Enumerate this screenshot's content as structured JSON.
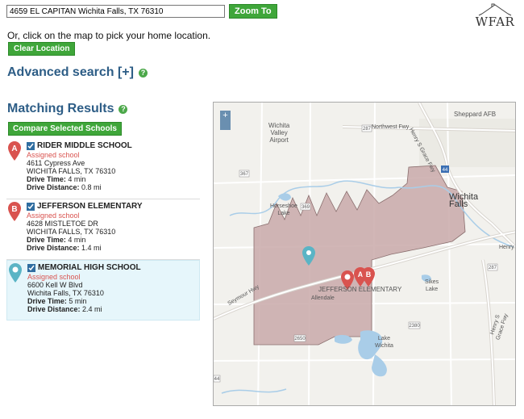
{
  "search": {
    "address_value": "4659 EL CAPITAN Wichita Falls, TX 76310",
    "zoom_label": "Zoom To"
  },
  "logo": {
    "text": "WFAR"
  },
  "pick_text": "Or, click on the map to pick your home location.",
  "clear_label": "Clear Location",
  "advanced": {
    "title": "Advanced search [+]"
  },
  "matching": {
    "title": "Matching Results",
    "compare_label": "Compare Selected Schools"
  },
  "results": [
    {
      "marker": "A",
      "name": "RIDER MIDDLE SCHOOL",
      "assigned": "Assigned school",
      "address1": "4611 Cypress Ave",
      "address2": "WICHITA FALLS, TX 76310",
      "drive_time_label": "Drive Time:",
      "drive_time": "4 min",
      "drive_distance_label": "Drive Distance:",
      "drive_distance": "0.8 mi",
      "color": "#d9534f"
    },
    {
      "marker": "B",
      "name": "JEFFERSON ELEMENTARY",
      "assigned": "Assigned school",
      "address1": "4628 MISTLETOE DR",
      "address2": "WICHITA FALLS, TX 76310",
      "drive_time_label": "Drive Time:",
      "drive_time": "4 min",
      "drive_distance_label": "Drive Distance:",
      "drive_distance": "1.4 mi",
      "color": "#d9534f"
    },
    {
      "marker": "",
      "name": "MEMORIAL HIGH SCHOOL",
      "assigned": "Assigned school",
      "address1": "6600 Kell W Blvd",
      "address2": "Wichita Falls, TX 76310",
      "drive_time_label": "Drive Time:",
      "drive_time": "5 min",
      "drive_distance_label": "Drive Distance:",
      "drive_distance": "2.4 mi",
      "color": "#5ab4c5"
    }
  ],
  "map": {
    "zoom_plus": "+",
    "labels": {
      "wichita_valley_airport": "Wichita\nValley\nAirport",
      "sheppard_afb": "Sheppard AFB",
      "northwest_fwy": "Northwest Fwy",
      "henry_grace_fwy_top": "Henry S Grace Fwy",
      "wichita_falls": "Wichita\nFalls",
      "horseshoe_lake": "Horseshoe\nLake",
      "seymour_hwy": "Seymour Hwy",
      "allendale": "Allendale",
      "jefferson_elementary": "JEFFERSON ELEMENTARY",
      "sikes_lake": "Sikes\nLake",
      "lake_wichita": "Lake\nWichita",
      "henry_grace_fwy_right": "Henry S Grace Fwy",
      "henry": "Henry",
      "route_287_top": "287",
      "route_287_right": "287",
      "route_367": "367",
      "route_369": "369",
      "route_2380": "2380",
      "route_2650": "2650",
      "route_44": "44",
      "route_i44": "44"
    },
    "markers": {
      "a": "A",
      "b": "B"
    },
    "colors": {
      "district": "#c9a9a9",
      "water": "#a9cde8",
      "road": "#ffffff"
    }
  }
}
